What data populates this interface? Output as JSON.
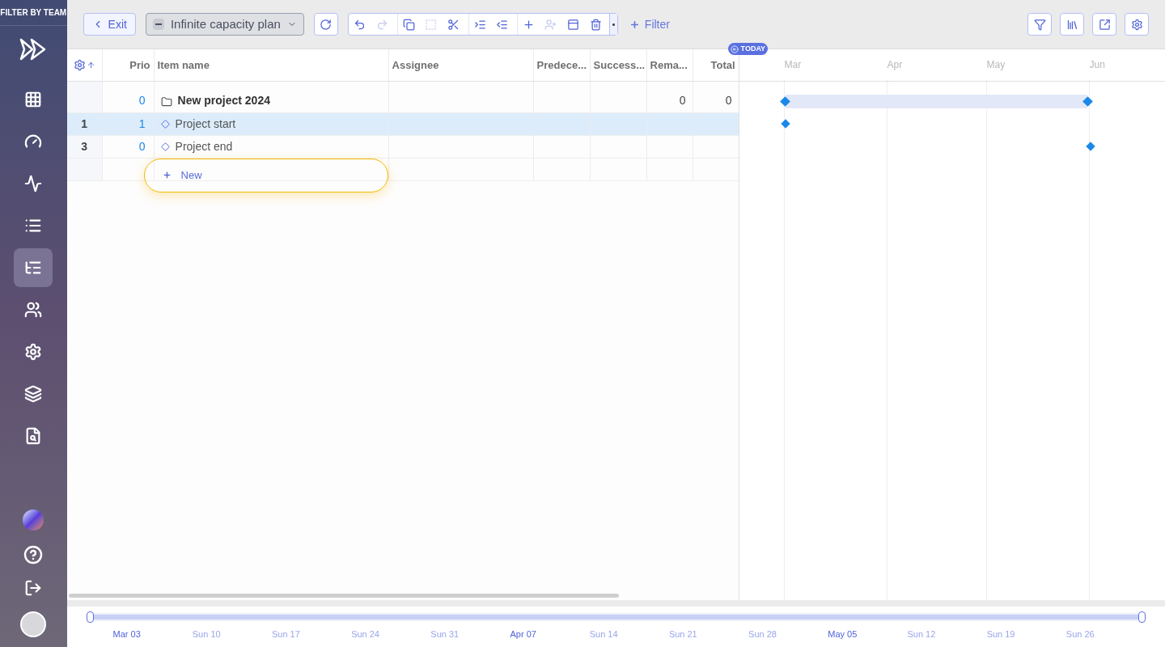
{
  "sidebar": {
    "header": "FILTER BY TEAM",
    "items": [
      {
        "kind": "grid",
        "selected": false
      },
      {
        "kind": "gauge",
        "selected": false
      },
      {
        "kind": "pulse",
        "selected": false
      },
      {
        "kind": "list",
        "selected": false
      },
      {
        "kind": "gantt",
        "selected": true
      },
      {
        "kind": "people",
        "selected": false
      },
      {
        "kind": "settings",
        "selected": false
      },
      {
        "kind": "layers",
        "selected": false
      },
      {
        "kind": "analytics",
        "selected": false
      }
    ],
    "bottom_items": [
      {
        "kind": "orb"
      },
      {
        "kind": "help"
      },
      {
        "kind": "logout"
      },
      {
        "kind": "avatar"
      }
    ]
  },
  "toolbar": {
    "exit": "Exit",
    "plan": "Infinite capacity plan",
    "filter": "Filter",
    "tools": [
      {
        "kind": "undo",
        "disabled": false
      },
      {
        "kind": "redo",
        "disabled": true
      },
      {
        "kind": "copy",
        "disabled": false
      },
      {
        "kind": "group",
        "disabled": true
      },
      {
        "kind": "cut",
        "disabled": false
      },
      {
        "kind": "indent",
        "disabled": false
      },
      {
        "kind": "outdent",
        "disabled": false
      },
      {
        "kind": "add",
        "disabled": false
      },
      {
        "kind": "assign",
        "disabled": true
      },
      {
        "kind": "details",
        "disabled": false
      },
      {
        "kind": "delete",
        "disabled": false
      }
    ]
  },
  "grid": {
    "columns": [
      "Prio",
      "Item name",
      "Assignee",
      "Predece...",
      "Success...",
      "Rema...",
      "Total"
    ],
    "rows": [
      {
        "number": "",
        "prio": "0",
        "name": "New project 2024",
        "kind": "project",
        "remaining": "0",
        "total": "0",
        "selected": false
      },
      {
        "number": "1",
        "prio": "1",
        "name": "Project start",
        "kind": "milestone",
        "remaining": "",
        "total": "",
        "selected": true
      },
      {
        "number": "3",
        "prio": "0",
        "name": "Project end",
        "kind": "milestone",
        "remaining": "",
        "total": "",
        "selected": false
      }
    ],
    "new_row": {
      "label": "New",
      "highlighted": true
    }
  },
  "timeline": {
    "today": "TODAY",
    "months": [
      "Mar",
      "Apr",
      "May",
      "Jun"
    ]
  },
  "range": {
    "level": 1,
    "labels": [
      {
        "text": "Mar 03",
        "kind": "month"
      },
      {
        "text": "Sun 10",
        "kind": "week"
      },
      {
        "text": "Sun 17",
        "kind": "week"
      },
      {
        "text": "Sun 24",
        "kind": "week"
      },
      {
        "text": "Sun 31",
        "kind": "week"
      },
      {
        "text": "Apr 07",
        "kind": "month"
      },
      {
        "text": "Sun 14",
        "kind": "week"
      },
      {
        "text": "Sun 21",
        "kind": "week"
      },
      {
        "text": "Sun 28",
        "kind": "week"
      },
      {
        "text": "May 05",
        "kind": "month"
      },
      {
        "text": "Sun 12",
        "kind": "week"
      },
      {
        "text": "Sun 19",
        "kind": "week"
      },
      {
        "text": "Sun 26",
        "kind": "week"
      }
    ]
  }
}
